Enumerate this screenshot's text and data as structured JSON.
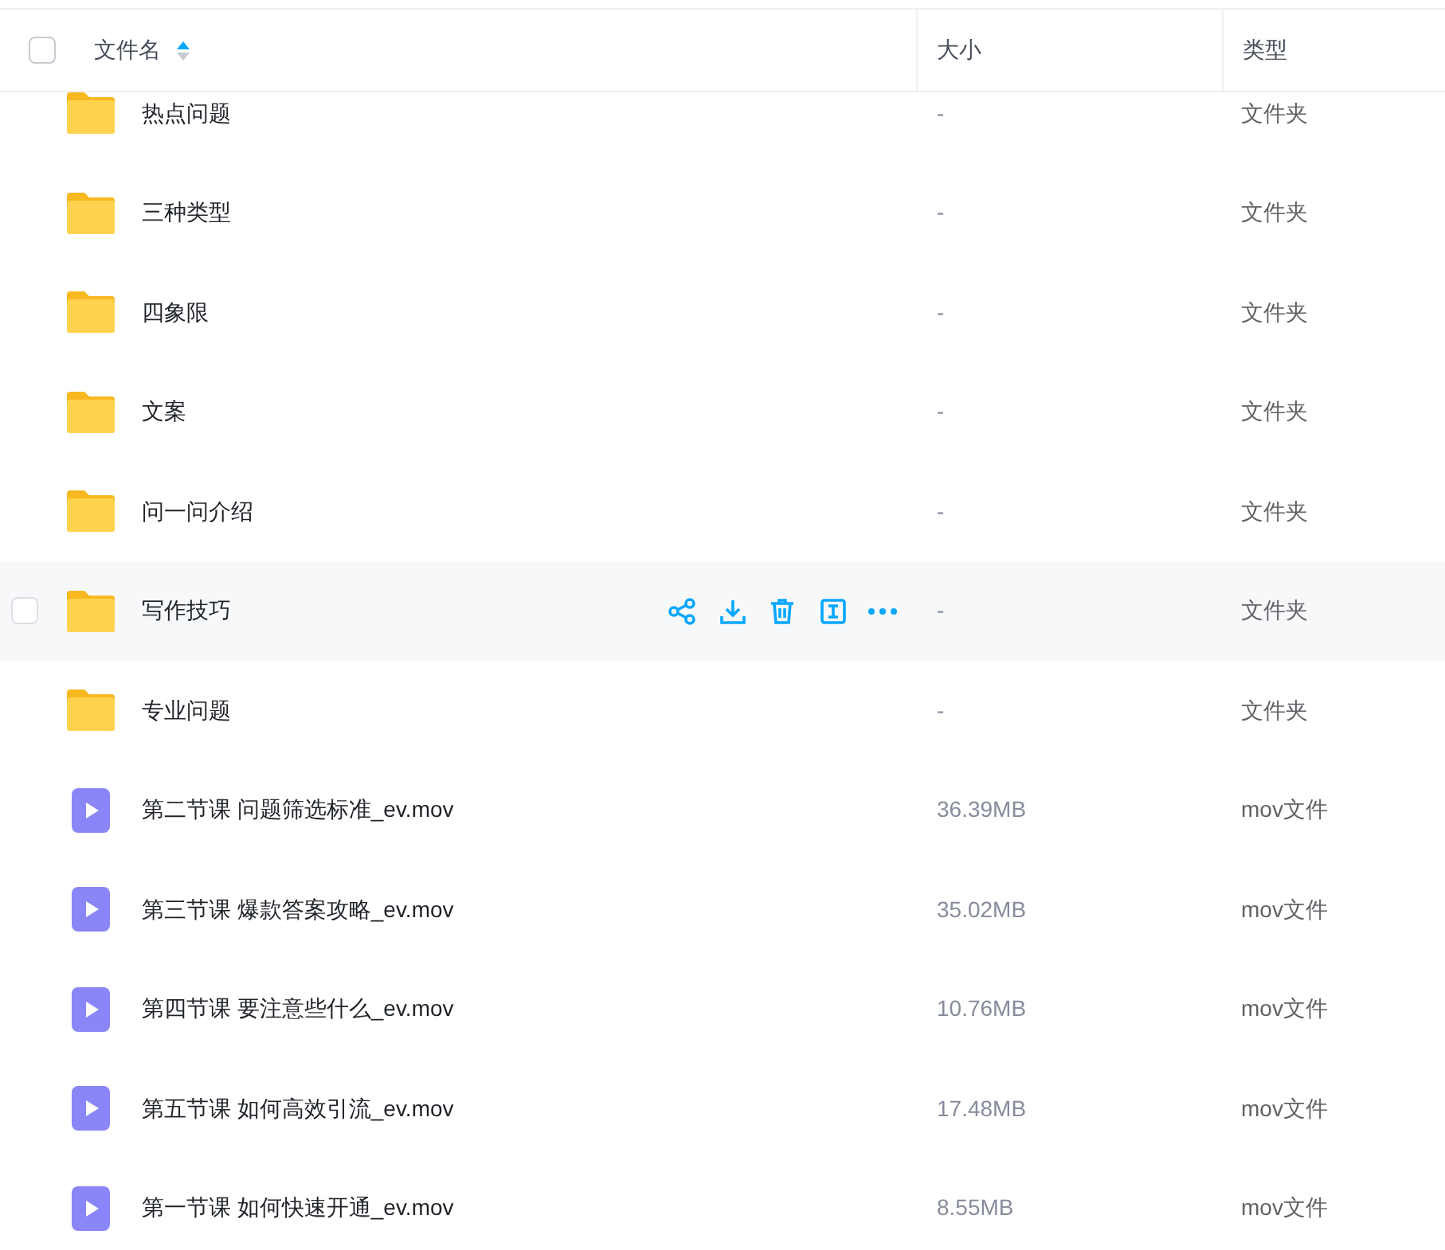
{
  "header": {
    "checked": false,
    "columns": [
      "文件名",
      "大小",
      "类型"
    ]
  },
  "rows": [
    {
      "kind": "folder",
      "name": "热点问题",
      "size": "-",
      "type": "文件夹",
      "hovered": false
    },
    {
      "kind": "folder",
      "name": "三种类型",
      "size": "-",
      "type": "文件夹",
      "hovered": false
    },
    {
      "kind": "folder",
      "name": "四象限",
      "size": "-",
      "type": "文件夹",
      "hovered": false
    },
    {
      "kind": "folder",
      "name": "文案",
      "size": "-",
      "type": "文件夹",
      "hovered": false
    },
    {
      "kind": "folder",
      "name": "问一问介绍",
      "size": "-",
      "type": "文件夹",
      "hovered": false
    },
    {
      "kind": "folder",
      "name": "写作技巧",
      "size": "-",
      "type": "文件夹",
      "hovered": true
    },
    {
      "kind": "folder",
      "name": "专业问题",
      "size": "-",
      "type": "文件夹",
      "hovered": false
    },
    {
      "kind": "video",
      "name": "第二节课 问题筛选标准_ev.mov",
      "size": "36.39MB",
      "type": "mov文件",
      "hovered": false
    },
    {
      "kind": "video",
      "name": "第三节课 爆款答案攻略_ev.mov",
      "size": "35.02MB",
      "type": "mov文件",
      "hovered": false
    },
    {
      "kind": "video",
      "name": "第四节课 要注意些什么_ev.mov",
      "size": "10.76MB",
      "type": "mov文件",
      "hovered": false
    },
    {
      "kind": "video",
      "name": "第五节课 如何高效引流_ev.mov",
      "size": "17.48MB",
      "type": "mov文件",
      "hovered": false
    },
    {
      "kind": "video",
      "name": "第一节课 如何快速开通_ev.mov",
      "size": "8.55MB",
      "type": "mov文件",
      "hovered": false
    }
  ]
}
